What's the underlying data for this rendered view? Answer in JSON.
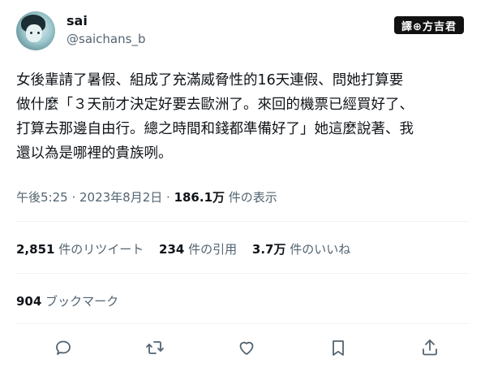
{
  "author": {
    "name": "sai",
    "handle": "@saichans_b"
  },
  "badge_text": "譯⊕方吉君",
  "tweet_lines": [
    "女後輩請了暑假、組成了充滿威脅性的16天連假、問她打算要",
    "做什麼「３天前才決定好要去歐洲了。來回的機票已經買好了、",
    "打算去那邊自由行。總之時間和錢都準備好了」她這麼說著、我",
    "還以為是哪裡的貴族咧。"
  ],
  "meta": {
    "time_date": "午後5:25 · 2023年8月2日 · ",
    "views_count": "186.1万",
    "views_label": " 件の表示"
  },
  "stats": {
    "retweets_count": "2,851",
    "retweets_label": " 件のリツイート",
    "quotes_count": "234",
    "quotes_label": " 件の引用",
    "likes_count": "3.7万",
    "likes_label": " 件のいいね"
  },
  "bookmarks": {
    "count": "904",
    "label": " ブックマーク"
  },
  "actions": {
    "reply_icon": "comment-bubble",
    "retweet_icon": "retweet-arrows",
    "like_icon": "heart",
    "bookmark_icon": "bookmark",
    "share_icon": "share-arrow"
  }
}
